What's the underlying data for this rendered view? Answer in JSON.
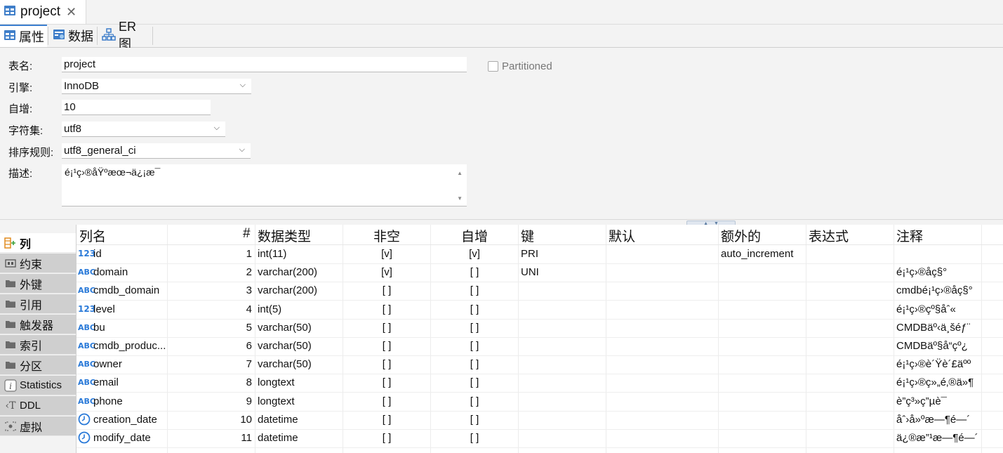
{
  "window": {
    "tab_title": "project"
  },
  "subtabs": [
    {
      "label": "属性",
      "icon": "table-icon"
    },
    {
      "label": "数据",
      "icon": "data-grid-icon"
    },
    {
      "label": "ER 图",
      "icon": "er-diagram-icon"
    }
  ],
  "form": {
    "table_name_label": "表名:",
    "table_name_value": "project",
    "engine_label": "引擎:",
    "engine_value": "InnoDB",
    "auto_inc_label": "自增:",
    "auto_inc_value": "10",
    "charset_label": "字符集:",
    "charset_value": "utf8",
    "collation_label": "排序规则:",
    "collation_value": "utf8_general_ci",
    "description_label": "描述:",
    "description_value": "é¡¹ç›®åŸºæœ¬ä¿¡æ¯",
    "partitioned_label": "Partitioned"
  },
  "sidebar": {
    "items": [
      {
        "label": "列",
        "icon": "columns-icon"
      },
      {
        "label": "约束",
        "icon": "constraint-icon"
      },
      {
        "label": "外键",
        "icon": "folder-icon"
      },
      {
        "label": "引用",
        "icon": "folder-icon"
      },
      {
        "label": "触发器",
        "icon": "folder-icon"
      },
      {
        "label": "索引",
        "icon": "folder-icon"
      },
      {
        "label": "分区",
        "icon": "folder-icon"
      },
      {
        "label": "Statistics",
        "icon": "info-icon"
      },
      {
        "label": "DDL",
        "icon": "ddl-icon"
      },
      {
        "label": "虚拟",
        "icon": "virtual-icon"
      }
    ]
  },
  "columns_grid": {
    "headers": {
      "name": "列名",
      "num": "#",
      "type": "数据类型",
      "not_null": "非空",
      "auto_inc": "自增",
      "key": "键",
      "default": "默认",
      "extra": "额外的",
      "expression": "表达式",
      "comment": "注释"
    },
    "rows": [
      {
        "icon": "123",
        "name": "id",
        "num": "1",
        "type": "int(11)",
        "not_null": "[v]",
        "auto_inc": "[v]",
        "key": "PRI",
        "default": "",
        "extra": "auto_increment",
        "expression": "",
        "comment": ""
      },
      {
        "icon": "abc",
        "name": "domain",
        "num": "2",
        "type": "varchar(200)",
        "not_null": "[v]",
        "auto_inc": "[ ]",
        "key": "UNI",
        "default": "",
        "extra": "",
        "expression": "",
        "comment": "é¡¹ç›®åç§°"
      },
      {
        "icon": "abc",
        "name": "cmdb_domain",
        "num": "3",
        "type": "varchar(200)",
        "not_null": "[ ]",
        "auto_inc": "[ ]",
        "key": "",
        "default": "",
        "extra": "",
        "expression": "",
        "comment": "cmdbé¡¹ç›®åç§°"
      },
      {
        "icon": "123",
        "name": "level",
        "num": "4",
        "type": "int(5)",
        "not_null": "[ ]",
        "auto_inc": "[ ]",
        "key": "",
        "default": "",
        "extra": "",
        "expression": "",
        "comment": "é¡¹ç›®çº§åˆ«"
      },
      {
        "icon": "abc",
        "name": "bu",
        "num": "5",
        "type": "varchar(50)",
        "not_null": "[ ]",
        "auto_inc": "[ ]",
        "key": "",
        "default": "",
        "extra": "",
        "expression": "",
        "comment": "CMDBäº‹ä¸šéƒ¨"
      },
      {
        "icon": "abc",
        "name": "cmdb_produc...",
        "num": "6",
        "type": "varchar(50)",
        "not_null": "[ ]",
        "auto_inc": "[ ]",
        "key": "",
        "default": "",
        "extra": "",
        "expression": "",
        "comment": "CMDBäº§å“çº¿"
      },
      {
        "icon": "abc",
        "name": "owner",
        "num": "7",
        "type": "varchar(50)",
        "not_null": "[ ]",
        "auto_inc": "[ ]",
        "key": "",
        "default": "",
        "extra": "",
        "expression": "",
        "comment": "é¡¹ç›®è´Ÿè´£äºº"
      },
      {
        "icon": "abc",
        "name": "email",
        "num": "8",
        "type": "longtext",
        "not_null": "[ ]",
        "auto_inc": "[ ]",
        "key": "",
        "default": "",
        "extra": "",
        "expression": "",
        "comment": "é¡¹ç›®ç»„é‚®ä»¶"
      },
      {
        "icon": "abc",
        "name": "phone",
        "num": "9",
        "type": "longtext",
        "not_null": "[ ]",
        "auto_inc": "[ ]",
        "key": "",
        "default": "",
        "extra": "",
        "expression": "",
        "comment": "è”ç³»ç”µè¯"
      },
      {
        "icon": "clock",
        "name": "creation_date",
        "num": "10",
        "type": "datetime",
        "not_null": "[ ]",
        "auto_inc": "[ ]",
        "key": "",
        "default": "",
        "extra": "",
        "expression": "",
        "comment": "åˆ›å»ºæ—¶é—´"
      },
      {
        "icon": "clock",
        "name": "modify_date",
        "num": "11",
        "type": "datetime",
        "not_null": "[ ]",
        "auto_inc": "[ ]",
        "key": "",
        "default": "",
        "extra": "",
        "expression": "",
        "comment": "ä¿®æ”¹æ—¶é—´"
      }
    ]
  }
}
